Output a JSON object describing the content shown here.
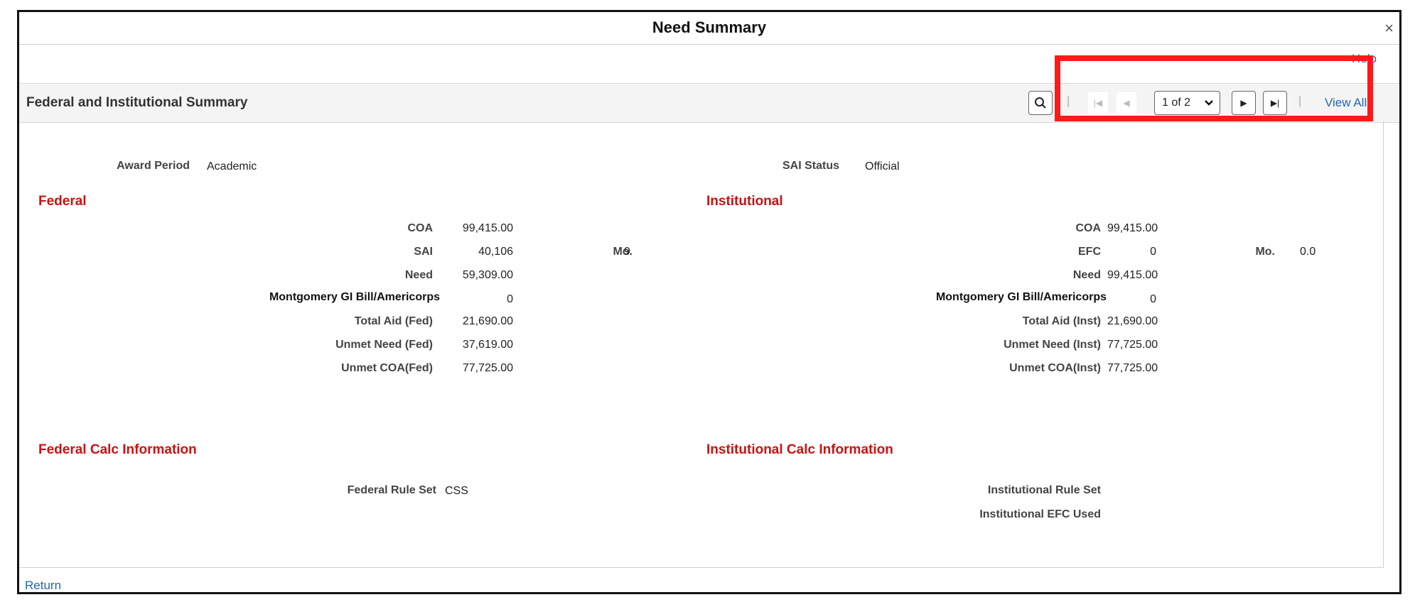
{
  "dialog": {
    "title": "Need Summary",
    "close_glyph": "×",
    "help_label": "Help",
    "return_label": "Return"
  },
  "grid": {
    "title": "Federal and Institutional Summary",
    "search_glyph": "⚲",
    "first_glyph": "|◀",
    "prev_glyph": "◀",
    "page_select": "1 of 2",
    "next_glyph": "▶",
    "last_glyph": "▶|",
    "separator": "|",
    "view_all_label": "View All"
  },
  "award_period": {
    "label": "Award Period",
    "value": "Academic"
  },
  "sai_status": {
    "label": "SAI Status",
    "value": "Official"
  },
  "federal": {
    "heading": "Federal",
    "coa": {
      "label": "COA",
      "value": "99,415.00"
    },
    "sai": {
      "label": "SAI",
      "value": "40,106"
    },
    "months": {
      "label": "Mo.",
      "value": "9"
    },
    "need": {
      "label": "Need",
      "value": "59,309.00"
    },
    "gi_bill": {
      "label": "Montgomery GI Bill/Americorps",
      "value": "0"
    },
    "total_aid": {
      "label": "Total Aid (Fed)",
      "value": "21,690.00"
    },
    "unmet_need": {
      "label": "Unmet Need (Fed)",
      "value": "37,619.00"
    },
    "unmet_coa": {
      "label": "Unmet COA(Fed)",
      "value": "77,725.00"
    }
  },
  "institutional": {
    "heading": "Institutional",
    "coa": {
      "label": "COA",
      "value": "99,415.00"
    },
    "efc": {
      "label": "EFC",
      "value": "0"
    },
    "months": {
      "label": "Mo.",
      "value": "0.0"
    },
    "need": {
      "label": "Need",
      "value": "99,415.00"
    },
    "gi_bill": {
      "label": "Montgomery GI Bill/Americorps",
      "value": "0"
    },
    "total_aid": {
      "label": "Total Aid (Inst)",
      "value": "21,690.00"
    },
    "unmet_need": {
      "label": "Unmet Need (Inst)",
      "value": "77,725.00"
    },
    "unmet_coa": {
      "label": "Unmet COA(Inst)",
      "value": "77,725.00"
    }
  },
  "federal_calc": {
    "heading": "Federal Calc Information",
    "rule_set": {
      "label": "Federal Rule Set",
      "value": "CSS"
    }
  },
  "institutional_calc": {
    "heading": "Institutional Calc Information",
    "rule_set": {
      "label": "Institutional Rule Set"
    },
    "efc_used": {
      "label": "Institutional EFC Used"
    }
  },
  "colors": {
    "highlight": "#ff1a1a",
    "section_heading": "#cc1111",
    "link": "#2266bb"
  }
}
